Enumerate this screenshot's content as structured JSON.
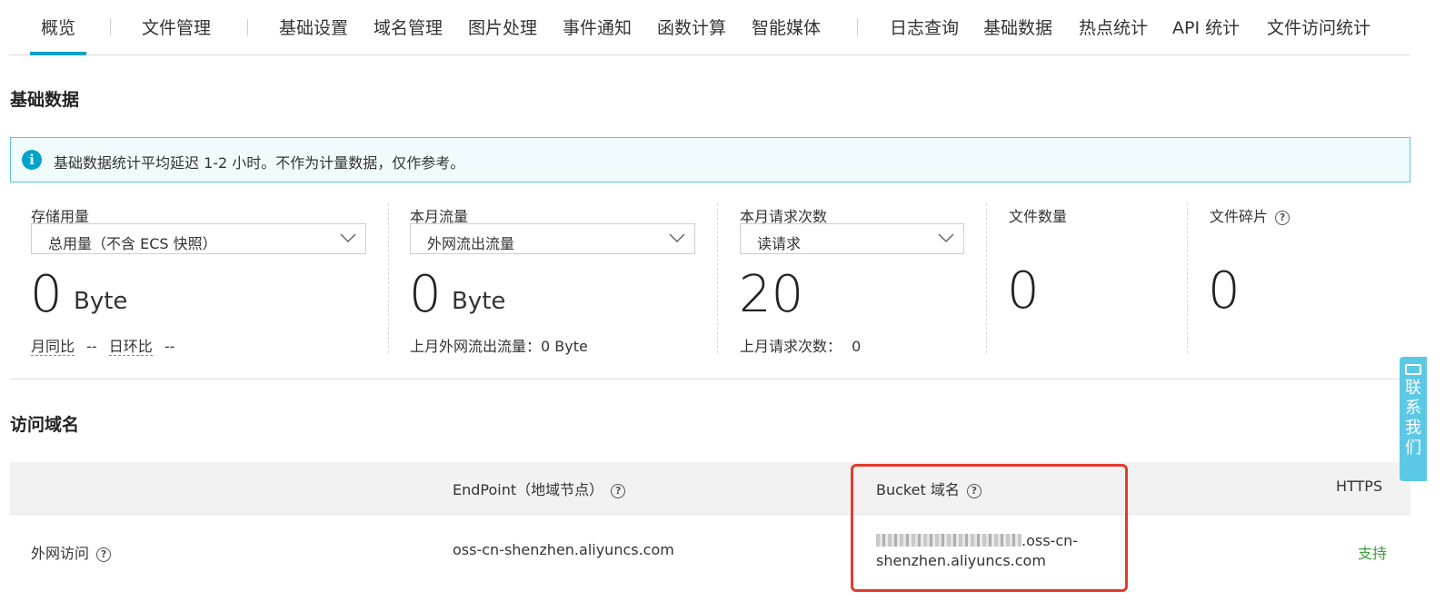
{
  "tabs": [
    {
      "label": "概览",
      "active": true
    },
    {
      "label": "文件管理"
    },
    {
      "label": "基础设置"
    },
    {
      "label": "域名管理"
    },
    {
      "label": "图片处理"
    },
    {
      "label": "事件通知"
    },
    {
      "label": "函数计算"
    },
    {
      "label": "智能媒体"
    },
    {
      "label": "日志查询"
    },
    {
      "label": "基础数据"
    },
    {
      "label": "热点统计"
    },
    {
      "label": "API 统计"
    },
    {
      "label": "文件访问统计"
    }
  ],
  "basic_data": {
    "title": "基础数据",
    "notice": "基础数据统计平均延迟 1-2 小时。不作为计量数据，仅作参考。",
    "storage": {
      "label": "存储用量",
      "select": "总用量（不含 ECS 快照）",
      "value": "0",
      "unit": "Byte",
      "mom_label": "月同比",
      "mom_value": "--",
      "dod_label": "日环比",
      "dod_value": "--"
    },
    "traffic": {
      "label": "本月流量",
      "select": "外网流出流量",
      "value": "0",
      "unit": "Byte",
      "last_month": "上月外网流出流量：0 Byte"
    },
    "requests": {
      "label": "本月请求次数",
      "select": "读请求",
      "value": "20",
      "last_month_label": "上月请求次数：",
      "last_month_value": "0"
    },
    "files": {
      "label": "文件数量",
      "value": "0"
    },
    "fragments": {
      "label": "文件碎片",
      "value": "0"
    }
  },
  "access_domain": {
    "title": "访问域名",
    "headers": {
      "endpoint": "EndPoint（地域节点）",
      "bucket": "Bucket 域名",
      "https": "HTTPS"
    },
    "rows": [
      {
        "name": "外网访问",
        "endpoint": "oss-cn-shenzhen.aliyuncs.com",
        "bucket_line1_suffix": ".oss-cn-",
        "bucket_line2": "shenzhen.aliyuncs.com",
        "https": "支持"
      }
    ]
  },
  "contact": {
    "chars": [
      "联",
      "系",
      "我",
      "们"
    ]
  },
  "colors": {
    "accent": "#00a2ca",
    "highlight_border": "#e53a2f",
    "support_text": "#3e9e3e"
  }
}
